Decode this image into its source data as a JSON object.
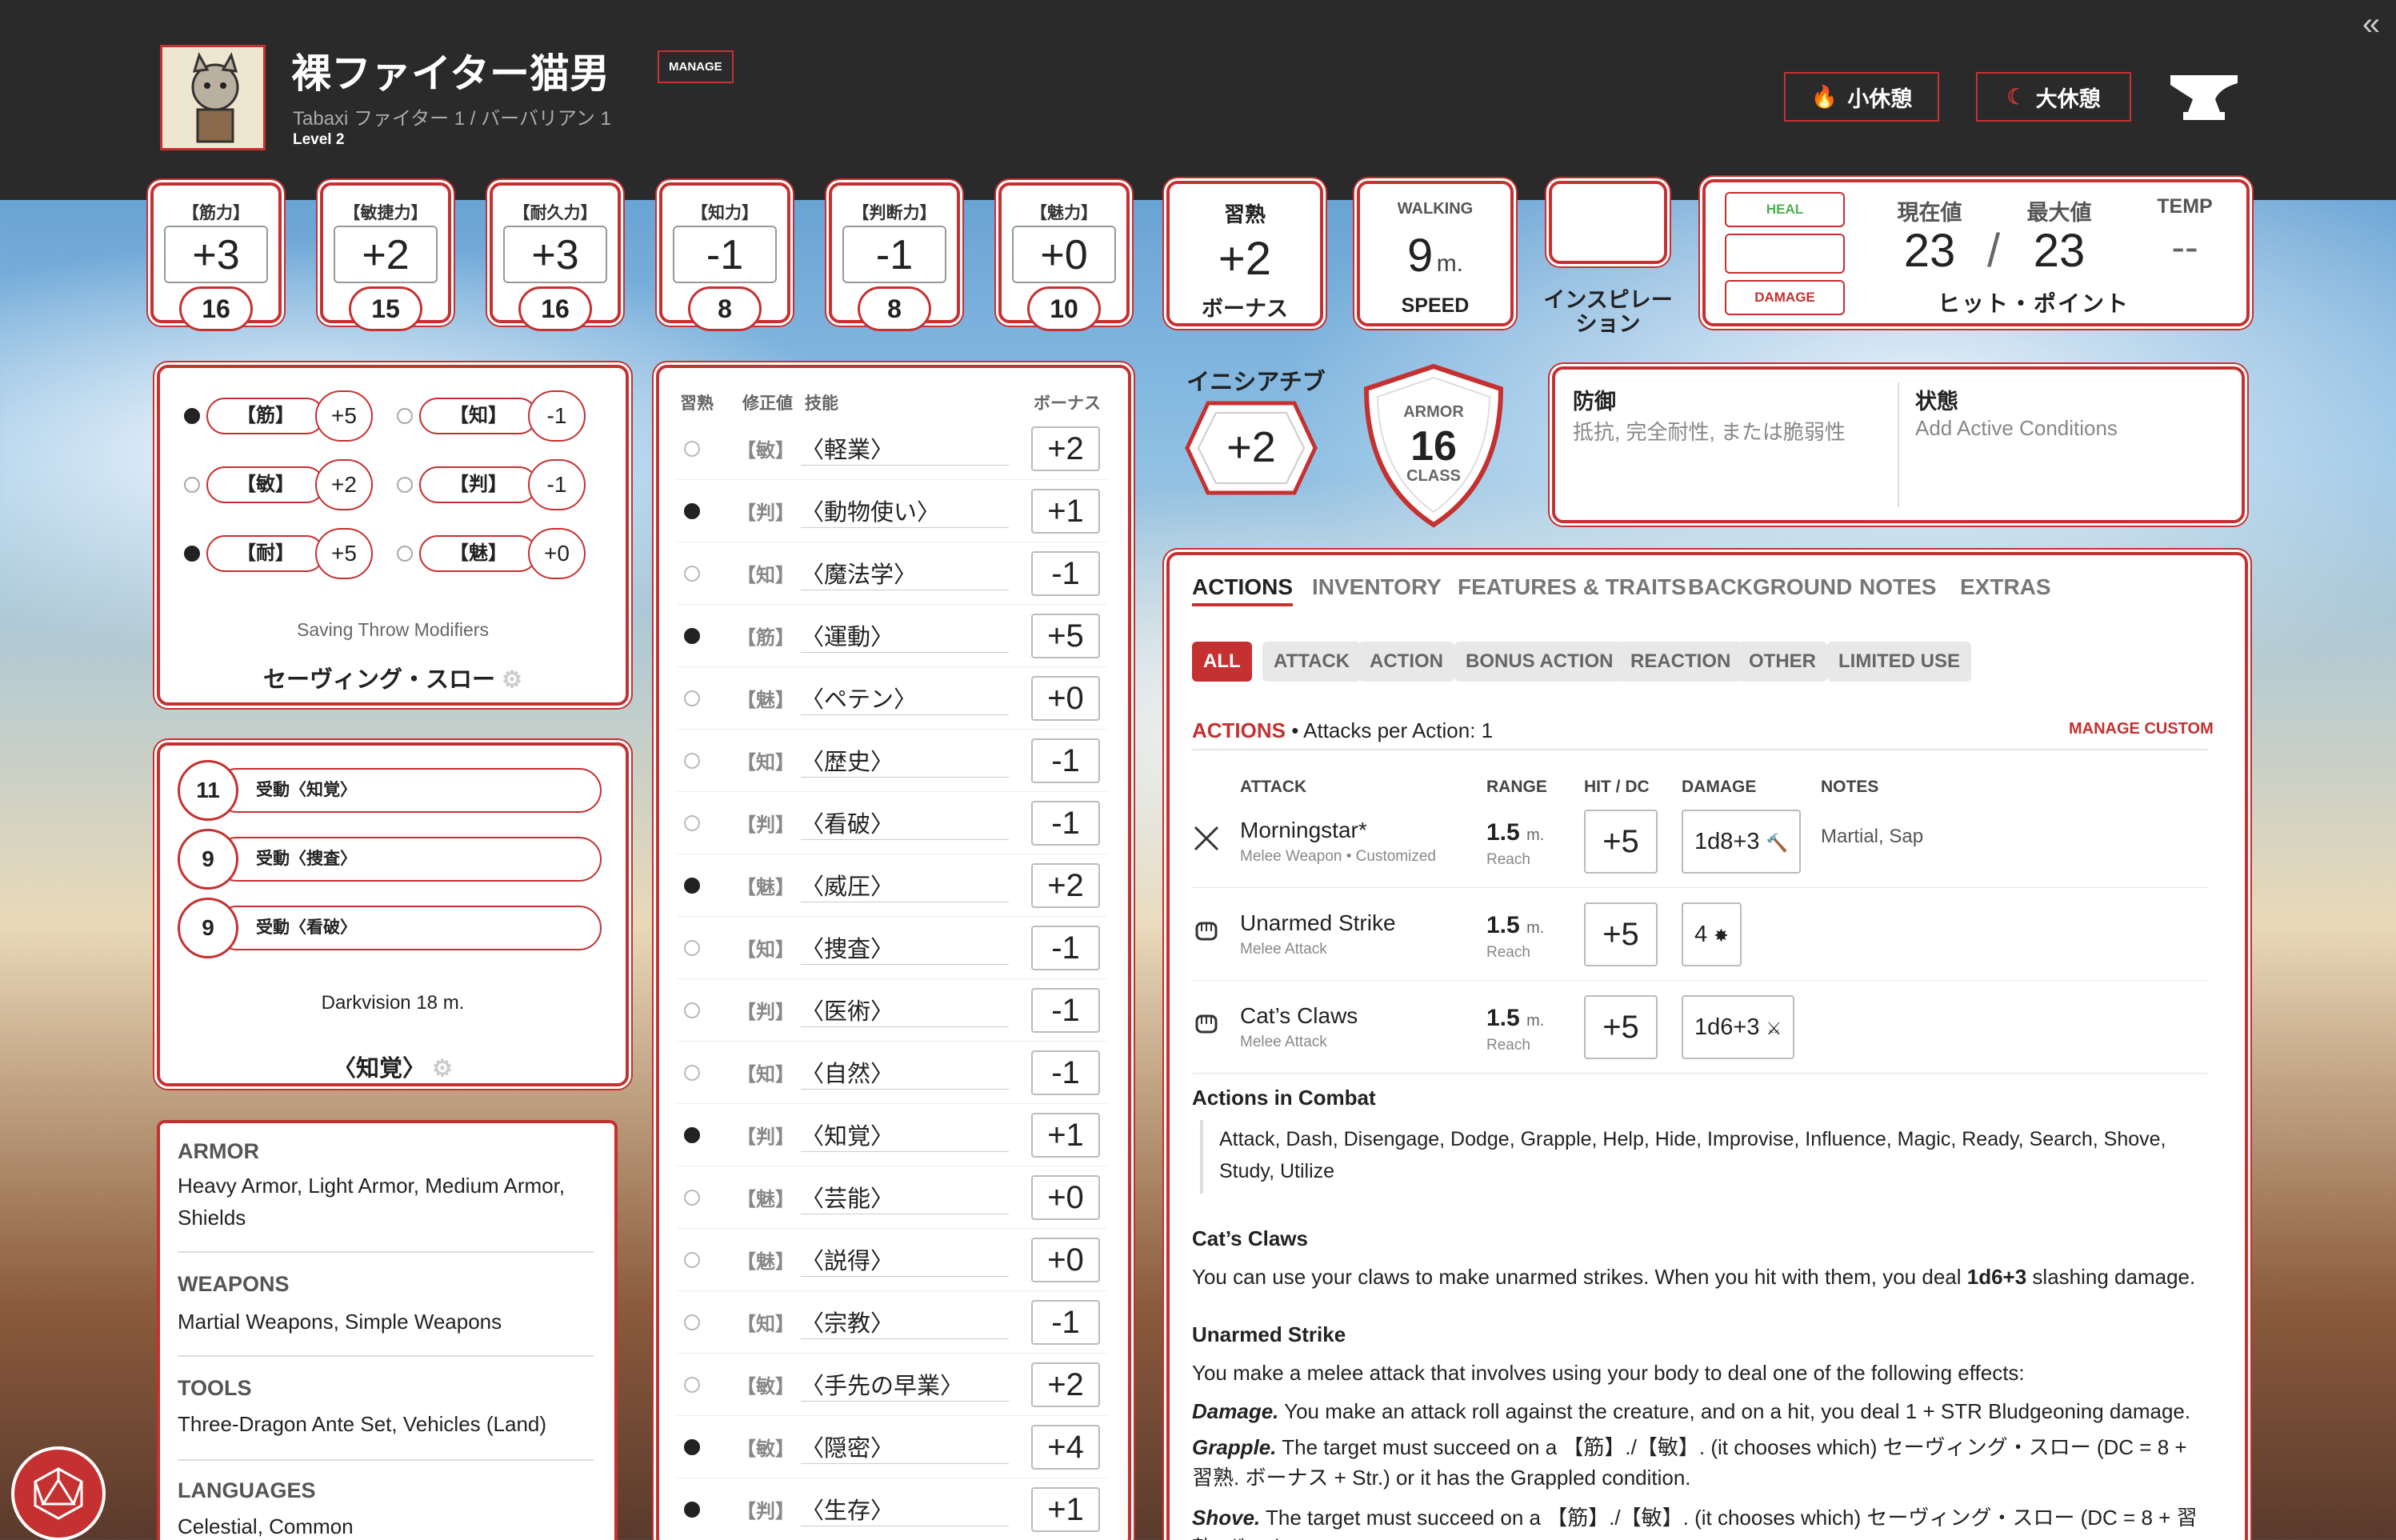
{
  "header": {
    "name": "裸ファイター猫男",
    "manage": "MANAGE",
    "subtitle": "Tabaxi ファイター 1 / バーバリアン 1",
    "level": "Level 2",
    "short_rest": "小休憩",
    "long_rest": "大休憩"
  },
  "abilities": [
    {
      "label": "【筋力】",
      "mod": "+3",
      "score": "16"
    },
    {
      "label": "【敏捷力】",
      "mod": "+2",
      "score": "15"
    },
    {
      "label": "【耐久力】",
      "mod": "+3",
      "score": "16"
    },
    {
      "label": "【知力】",
      "mod": "-1",
      "score": "8"
    },
    {
      "label": "【判断力】",
      "mod": "-1",
      "score": "8"
    },
    {
      "label": "【魅力】",
      "mod": "+0",
      "score": "10"
    }
  ],
  "proficiency": {
    "head": "習熟",
    "value": "+2",
    "foot": "ボーナス"
  },
  "speed": {
    "head": "WALKING",
    "value": "9",
    "unit": "m.",
    "foot": "SPEED"
  },
  "inspiration": {
    "label": "インスピレーション"
  },
  "hp": {
    "heal": "HEAL",
    "damage": "DAMAGE",
    "current_label": "現在値",
    "max_label": "最大値",
    "temp_label": "TEMP",
    "current": "23",
    "slash": "/",
    "max": "23",
    "temp": "--",
    "foot": "ヒット・ポイント"
  },
  "initiative": {
    "label": "イニシアチブ",
    "value": "+2"
  },
  "armor": {
    "top": "ARMOR",
    "value": "16",
    "bottom": "CLASS"
  },
  "defenses": {
    "title": "防御",
    "placeholder": "抵抗, 完全耐性, または脆弱性",
    "cond_title": "状態",
    "cond_placeholder": "Add Active Conditions"
  },
  "saves": {
    "items": [
      {
        "label": "【筋】",
        "value": "+5",
        "prof": true
      },
      {
        "label": "【知】",
        "value": "-1",
        "prof": false
      },
      {
        "label": "【敏】",
        "value": "+2",
        "prof": false
      },
      {
        "label": "【判】",
        "value": "-1",
        "prof": false
      },
      {
        "label": "【耐】",
        "value": "+5",
        "prof": true
      },
      {
        "label": "【魅】",
        "value": "+0",
        "prof": false
      }
    ],
    "modifiers": "Saving Throw Modifiers",
    "title": "セーヴィング・スロー"
  },
  "passives": {
    "items": [
      {
        "value": "11",
        "label": "受動〈知覚〉"
      },
      {
        "value": "9",
        "label": "受動〈捜査〉"
      },
      {
        "value": "9",
        "label": "受動〈看破〉"
      }
    ],
    "senses": "Darkvision 18 m.",
    "title": "〈知覚〉"
  },
  "proficiencies": {
    "armor_head": "ARMOR",
    "armor": "Heavy Armor, Light Armor, Medium Armor, Shields",
    "weapons_head": "WEAPONS",
    "weapons": "Martial Weapons, Simple Weapons",
    "tools_head": "TOOLS",
    "tools": "Three-Dragon Ante Set, Vehicles (Land)",
    "languages_head": "LANGUAGES",
    "languages": "Celestial, Common"
  },
  "skills": {
    "headers": {
      "prof": "習熟",
      "mod": "修正値",
      "skill": "技能",
      "bonus": "ボーナス"
    },
    "items": [
      {
        "attr": "【敏】",
        "name": "〈軽業〉",
        "value": "+2",
        "prof": false
      },
      {
        "attr": "【判】",
        "name": "〈動物使い〉",
        "value": "+1",
        "prof": true
      },
      {
        "attr": "【知】",
        "name": "〈魔法学〉",
        "value": "-1",
        "prof": false
      },
      {
        "attr": "【筋】",
        "name": "〈運動〉",
        "value": "+5",
        "prof": true
      },
      {
        "attr": "【魅】",
        "name": "〈ペテン〉",
        "value": "+0",
        "prof": false
      },
      {
        "attr": "【知】",
        "name": "〈歴史〉",
        "value": "-1",
        "prof": false
      },
      {
        "attr": "【判】",
        "name": "〈看破〉",
        "value": "-1",
        "prof": false
      },
      {
        "attr": "【魅】",
        "name": "〈威圧〉",
        "value": "+2",
        "prof": true
      },
      {
        "attr": "【知】",
        "name": "〈捜査〉",
        "value": "-1",
        "prof": false
      },
      {
        "attr": "【判】",
        "name": "〈医術〉",
        "value": "-1",
        "prof": false
      },
      {
        "attr": "【知】",
        "name": "〈自然〉",
        "value": "-1",
        "prof": false
      },
      {
        "attr": "【判】",
        "name": "〈知覚〉",
        "value": "+1",
        "prof": true
      },
      {
        "attr": "【魅】",
        "name": "〈芸能〉",
        "value": "+0",
        "prof": false
      },
      {
        "attr": "【魅】",
        "name": "〈説得〉",
        "value": "+0",
        "prof": false
      },
      {
        "attr": "【知】",
        "name": "〈宗教〉",
        "value": "-1",
        "prof": false
      },
      {
        "attr": "【敏】",
        "name": "〈手先の早業〉",
        "value": "+2",
        "prof": false
      },
      {
        "attr": "【敏】",
        "name": "〈隠密〉",
        "value": "+4",
        "prof": true
      },
      {
        "attr": "【判】",
        "name": "〈生存〉",
        "value": "+1",
        "prof": true
      }
    ]
  },
  "actions": {
    "tabs": [
      "ACTIONS",
      "INVENTORY",
      "FEATURES & TRAITS",
      "BACKGROUND",
      "NOTES",
      "EXTRAS"
    ],
    "filters": [
      "ALL",
      "ATTACK",
      "ACTION",
      "BONUS ACTION",
      "REACTION",
      "OTHER",
      "LIMITED USE"
    ],
    "section_title": "ACTIONS",
    "section_sub": "• Attacks per Action: 1",
    "manage_custom": "MANAGE CUSTOM",
    "columns": {
      "attack": "ATTACK",
      "range": "RANGE",
      "hit": "HIT / DC",
      "damage": "DAMAGE",
      "notes": "NOTES"
    },
    "attacks": [
      {
        "name": "Morningstar*",
        "sub": "Melee Weapon • Customized",
        "range": "1.5",
        "unit": "m.",
        "reach": "Reach",
        "hit": "+5",
        "damage": "1d8+3",
        "notes": "Martial, Sap"
      },
      {
        "name": "Unarmed Strike",
        "sub": "Melee Attack",
        "range": "1.5",
        "unit": "m.",
        "reach": "Reach",
        "hit": "+5",
        "damage": "4",
        "notes": ""
      },
      {
        "name": "Cat’s Claws",
        "sub": "Melee Attack",
        "range": "1.5",
        "unit": "m.",
        "reach": "Reach",
        "hit": "+5",
        "damage": "1d6+3",
        "notes": ""
      }
    ],
    "combat_title": "Actions in Combat",
    "combat_list": "Attack, Dash, Disengage, Dodge, Grapple, Help, Hide, Improvise, Influence, Magic, Ready, Search, Shove, Study, Utilize",
    "claws_title": "Cat’s Claws",
    "claws_text_a": "You can use your claws to make unarmed strikes. When you hit with them, you deal ",
    "claws_bold": "1d6+3",
    "claws_text_b": " slashing damage.",
    "unarmed_title": "Unarmed Strike",
    "unarmed_intro": "You make a melee attack that involves using your body to deal one of the following effects:",
    "damage_label": "Damage.",
    "damage_text": " You make an attack roll against the creature, and on a hit, you deal 1 + STR Bludgeoning damage.",
    "grapple_label": "Grapple.",
    "grapple_text": " The target must succeed on a 【筋】./【敏】. (it chooses which) セーヴィング・スロー (DC = 8 + 習熟. ボーナス + Str.) or it has the Grappled condition.",
    "shove_label": "Shove.",
    "shove_text": " The target must succeed on a 【筋】./【敏】. (it chooses which) セーヴィング・スロー (DC = 8 + 習熟. ボーナス + Str.) or you either push it 1.5 m. away or it has the Prone condition."
  }
}
